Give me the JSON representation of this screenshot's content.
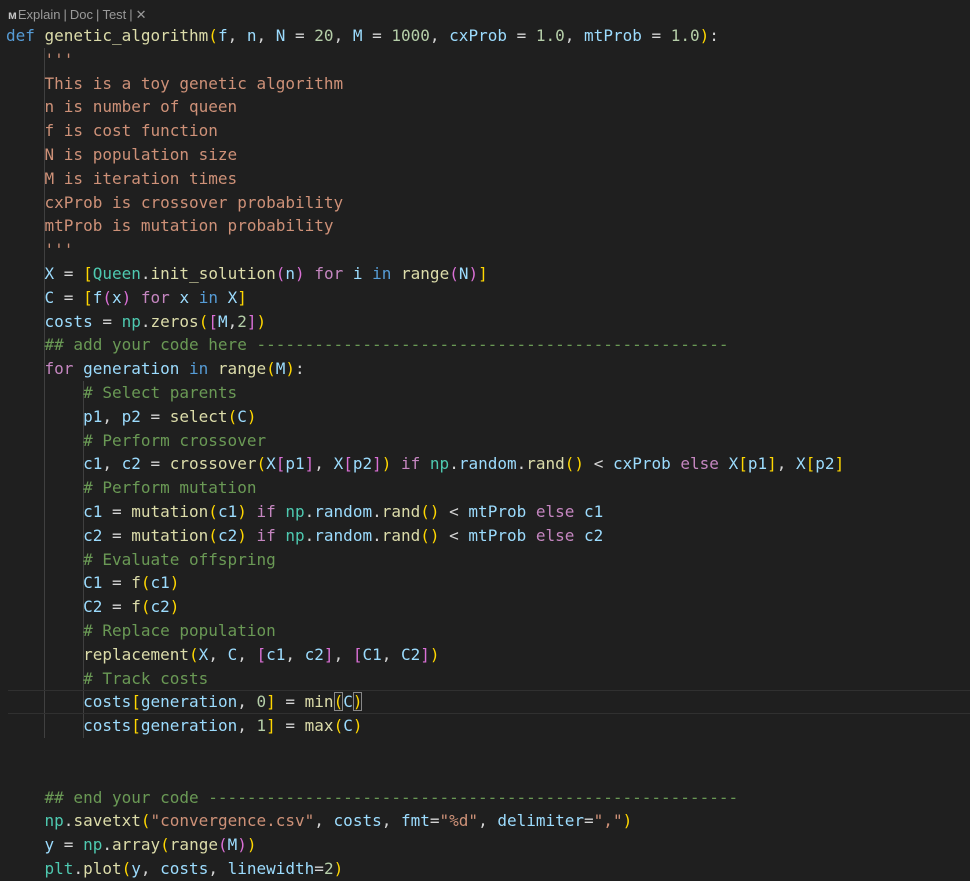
{
  "codelens": {
    "explain": "Explain",
    "doc": "Doc",
    "test": "Test",
    "separator": "|"
  },
  "colors": {
    "background": "#1f1f1f",
    "keyword": "#569cd6",
    "function": "#dcdcaa",
    "variable": "#9cdcfe",
    "class": "#4ec9b0",
    "number": "#b5cea8",
    "string": "#ce9178",
    "comment": "#6a9955",
    "control": "#c586c0"
  },
  "lines": [
    [
      [
        "kw",
        "def "
      ],
      [
        "fn",
        "genetic_algorithm"
      ],
      [
        "b1",
        "("
      ],
      [
        "id",
        "f"
      ],
      [
        "p",
        ", "
      ],
      [
        "id",
        "n"
      ],
      [
        "p",
        ", "
      ],
      [
        "id",
        "N"
      ],
      [
        "p",
        " = "
      ],
      [
        "num",
        "20"
      ],
      [
        "p",
        ", "
      ],
      [
        "id",
        "M"
      ],
      [
        "p",
        " = "
      ],
      [
        "num",
        "1000"
      ],
      [
        "p",
        ", "
      ],
      [
        "id",
        "cxProb"
      ],
      [
        "p",
        " = "
      ],
      [
        "num",
        "1.0"
      ],
      [
        "p",
        ", "
      ],
      [
        "id",
        "mtProb"
      ],
      [
        "p",
        " = "
      ],
      [
        "num",
        "1.0"
      ],
      [
        "b1",
        ")"
      ],
      [
        "p",
        ":"
      ]
    ],
    [
      [
        "p",
        "    "
      ],
      [
        "str",
        "'''"
      ]
    ],
    [
      [
        "p",
        "    "
      ],
      [
        "str",
        "This is a toy genetic algorithm"
      ]
    ],
    [
      [
        "p",
        "    "
      ],
      [
        "str",
        "n is number of queen"
      ]
    ],
    [
      [
        "p",
        "    "
      ],
      [
        "str",
        "f is cost function"
      ]
    ],
    [
      [
        "p",
        "    "
      ],
      [
        "str",
        "N is population size"
      ]
    ],
    [
      [
        "p",
        "    "
      ],
      [
        "str",
        "M is iteration times"
      ]
    ],
    [
      [
        "p",
        "    "
      ],
      [
        "str",
        "cxProb is crossover probability"
      ]
    ],
    [
      [
        "p",
        "    "
      ],
      [
        "str",
        "mtProb is mutation probability"
      ]
    ],
    [
      [
        "p",
        "    "
      ],
      [
        "str",
        "'''"
      ]
    ],
    [
      [
        "p",
        "    "
      ],
      [
        "id",
        "X"
      ],
      [
        "p",
        " = "
      ],
      [
        "b1",
        "["
      ],
      [
        "cl",
        "Queen"
      ],
      [
        "p",
        "."
      ],
      [
        "fn",
        "init_solution"
      ],
      [
        "b2",
        "("
      ],
      [
        "id",
        "n"
      ],
      [
        "b2",
        ")"
      ],
      [
        "ctl",
        " for "
      ],
      [
        "id",
        "i"
      ],
      [
        "kw",
        " in "
      ],
      [
        "fn",
        "range"
      ],
      [
        "b2",
        "("
      ],
      [
        "id",
        "N"
      ],
      [
        "b2",
        ")"
      ],
      [
        "b1",
        "]"
      ]
    ],
    [
      [
        "p",
        "    "
      ],
      [
        "id",
        "C"
      ],
      [
        "p",
        " = "
      ],
      [
        "b1",
        "["
      ],
      [
        "id",
        "f"
      ],
      [
        "b2",
        "("
      ],
      [
        "id",
        "x"
      ],
      [
        "b2",
        ")"
      ],
      [
        "ctl",
        " for "
      ],
      [
        "id",
        "x"
      ],
      [
        "kw",
        " in "
      ],
      [
        "id",
        "X"
      ],
      [
        "b1",
        "]"
      ]
    ],
    [
      [
        "p",
        "    "
      ],
      [
        "id",
        "costs"
      ],
      [
        "p",
        " = "
      ],
      [
        "cl",
        "np"
      ],
      [
        "p",
        "."
      ],
      [
        "fn",
        "zeros"
      ],
      [
        "b1",
        "("
      ],
      [
        "b2",
        "["
      ],
      [
        "id",
        "M"
      ],
      [
        "p",
        ","
      ],
      [
        "num",
        "2"
      ],
      [
        "b2",
        "]"
      ],
      [
        "b1",
        ")"
      ]
    ],
    [
      [
        "p",
        "    "
      ],
      [
        "cm",
        "## add your code here -------------------------------------------------"
      ]
    ],
    [
      [
        "p",
        "    "
      ],
      [
        "ctl",
        "for "
      ],
      [
        "id",
        "generation"
      ],
      [
        "kw",
        " in "
      ],
      [
        "fn",
        "range"
      ],
      [
        "b1",
        "("
      ],
      [
        "id",
        "M"
      ],
      [
        "b1",
        ")"
      ],
      [
        "p",
        ":"
      ]
    ],
    [
      [
        "p",
        "        "
      ],
      [
        "cm",
        "# Select parents"
      ]
    ],
    [
      [
        "p",
        "        "
      ],
      [
        "id",
        "p1"
      ],
      [
        "p",
        ", "
      ],
      [
        "id",
        "p2"
      ],
      [
        "p",
        " = "
      ],
      [
        "fn",
        "select"
      ],
      [
        "b1",
        "("
      ],
      [
        "id",
        "C"
      ],
      [
        "b1",
        ")"
      ]
    ],
    [
      [
        "p",
        "        "
      ],
      [
        "cm",
        "# Perform crossover"
      ]
    ],
    [
      [
        "p",
        "        "
      ],
      [
        "id",
        "c1"
      ],
      [
        "p",
        ", "
      ],
      [
        "id",
        "c2"
      ],
      [
        "p",
        " = "
      ],
      [
        "fn",
        "crossover"
      ],
      [
        "b1",
        "("
      ],
      [
        "id",
        "X"
      ],
      [
        "b2",
        "["
      ],
      [
        "id",
        "p1"
      ],
      [
        "b2",
        "]"
      ],
      [
        "p",
        ", "
      ],
      [
        "id",
        "X"
      ],
      [
        "b2",
        "["
      ],
      [
        "id",
        "p2"
      ],
      [
        "b2",
        "]"
      ],
      [
        "b1",
        ")"
      ],
      [
        "ctl",
        " if "
      ],
      [
        "cl",
        "np"
      ],
      [
        "p",
        "."
      ],
      [
        "id",
        "random"
      ],
      [
        "p",
        "."
      ],
      [
        "fn",
        "rand"
      ],
      [
        "b1",
        "()"
      ],
      [
        "p",
        " < "
      ],
      [
        "id",
        "cxProb"
      ],
      [
        "ctl",
        " else "
      ],
      [
        "id",
        "X"
      ],
      [
        "b1",
        "["
      ],
      [
        "id",
        "p1"
      ],
      [
        "b1",
        "]"
      ],
      [
        "p",
        ", "
      ],
      [
        "id",
        "X"
      ],
      [
        "b1",
        "["
      ],
      [
        "id",
        "p2"
      ],
      [
        "b1",
        "]"
      ]
    ],
    [
      [
        "p",
        "        "
      ],
      [
        "cm",
        "# Perform mutation"
      ]
    ],
    [
      [
        "p",
        "        "
      ],
      [
        "id",
        "c1"
      ],
      [
        "p",
        " = "
      ],
      [
        "fn",
        "mutation"
      ],
      [
        "b1",
        "("
      ],
      [
        "id",
        "c1"
      ],
      [
        "b1",
        ")"
      ],
      [
        "ctl",
        " if "
      ],
      [
        "cl",
        "np"
      ],
      [
        "p",
        "."
      ],
      [
        "id",
        "random"
      ],
      [
        "p",
        "."
      ],
      [
        "fn",
        "rand"
      ],
      [
        "b1",
        "()"
      ],
      [
        "p",
        " < "
      ],
      [
        "id",
        "mtProb"
      ],
      [
        "ctl",
        " else "
      ],
      [
        "id",
        "c1"
      ]
    ],
    [
      [
        "p",
        "        "
      ],
      [
        "id",
        "c2"
      ],
      [
        "p",
        " = "
      ],
      [
        "fn",
        "mutation"
      ],
      [
        "b1",
        "("
      ],
      [
        "id",
        "c2"
      ],
      [
        "b1",
        ")"
      ],
      [
        "ctl",
        " if "
      ],
      [
        "cl",
        "np"
      ],
      [
        "p",
        "."
      ],
      [
        "id",
        "random"
      ],
      [
        "p",
        "."
      ],
      [
        "fn",
        "rand"
      ],
      [
        "b1",
        "()"
      ],
      [
        "p",
        " < "
      ],
      [
        "id",
        "mtProb"
      ],
      [
        "ctl",
        " else "
      ],
      [
        "id",
        "c2"
      ]
    ],
    [
      [
        "p",
        "        "
      ],
      [
        "cm",
        "# Evaluate offspring"
      ]
    ],
    [
      [
        "p",
        "        "
      ],
      [
        "id",
        "C1"
      ],
      [
        "p",
        " = "
      ],
      [
        "fn",
        "f"
      ],
      [
        "b1",
        "("
      ],
      [
        "id",
        "c1"
      ],
      [
        "b1",
        ")"
      ]
    ],
    [
      [
        "p",
        "        "
      ],
      [
        "id",
        "C2"
      ],
      [
        "p",
        " = "
      ],
      [
        "fn",
        "f"
      ],
      [
        "b1",
        "("
      ],
      [
        "id",
        "c2"
      ],
      [
        "b1",
        ")"
      ]
    ],
    [
      [
        "p",
        "        "
      ],
      [
        "cm",
        "# Replace population"
      ]
    ],
    [
      [
        "p",
        "        "
      ],
      [
        "fn",
        "replacement"
      ],
      [
        "b1",
        "("
      ],
      [
        "id",
        "X"
      ],
      [
        "p",
        ", "
      ],
      [
        "id",
        "C"
      ],
      [
        "p",
        ", "
      ],
      [
        "b2",
        "["
      ],
      [
        "id",
        "c1"
      ],
      [
        "p",
        ", "
      ],
      [
        "id",
        "c2"
      ],
      [
        "b2",
        "]"
      ],
      [
        "p",
        ", "
      ],
      [
        "b2",
        "["
      ],
      [
        "id",
        "C1"
      ],
      [
        "p",
        ", "
      ],
      [
        "id",
        "C2"
      ],
      [
        "b2",
        "]"
      ],
      [
        "b1",
        ")"
      ]
    ],
    [
      [
        "p",
        "        "
      ],
      [
        "cm",
        "# Track costs"
      ]
    ],
    [
      [
        "p",
        "        "
      ],
      [
        "id",
        "costs"
      ],
      [
        "b1",
        "["
      ],
      [
        "id",
        "generation"
      ],
      [
        "p",
        ", "
      ],
      [
        "num",
        "0"
      ],
      [
        "b1",
        "]"
      ],
      [
        "p",
        " = "
      ],
      [
        "fn",
        "min"
      ],
      [
        "b1 br",
        "("
      ],
      [
        "id",
        "C"
      ],
      [
        "b1 br",
        ")"
      ]
    ],
    [
      [
        "p",
        "        "
      ],
      [
        "id",
        "costs"
      ],
      [
        "b1",
        "["
      ],
      [
        "id",
        "generation"
      ],
      [
        "p",
        ", "
      ],
      [
        "num",
        "1"
      ],
      [
        "b1",
        "]"
      ],
      [
        "p",
        " = "
      ],
      [
        "fn",
        "max"
      ],
      [
        "b1",
        "("
      ],
      [
        "id",
        "C"
      ],
      [
        "b1",
        ")"
      ]
    ],
    [],
    [],
    [
      [
        "p",
        "    "
      ],
      [
        "cm",
        "## end your code -------------------------------------------------------"
      ]
    ],
    [
      [
        "p",
        "    "
      ],
      [
        "cl",
        "np"
      ],
      [
        "p",
        "."
      ],
      [
        "fn",
        "savetxt"
      ],
      [
        "b1",
        "("
      ],
      [
        "str",
        "\"convergence.csv\""
      ],
      [
        "p",
        ", "
      ],
      [
        "id",
        "costs"
      ],
      [
        "p",
        ", "
      ],
      [
        "id",
        "fmt"
      ],
      [
        "p",
        "="
      ],
      [
        "str",
        "\"%d\""
      ],
      [
        "p",
        ", "
      ],
      [
        "id",
        "delimiter"
      ],
      [
        "p",
        "="
      ],
      [
        "str",
        "\",\""
      ],
      [
        "b1",
        ")"
      ]
    ],
    [
      [
        "p",
        "    "
      ],
      [
        "id",
        "y"
      ],
      [
        "p",
        " = "
      ],
      [
        "cl",
        "np"
      ],
      [
        "p",
        "."
      ],
      [
        "fn",
        "array"
      ],
      [
        "b1",
        "("
      ],
      [
        "fn",
        "range"
      ],
      [
        "b2",
        "("
      ],
      [
        "id",
        "M"
      ],
      [
        "b2",
        ")"
      ],
      [
        "b1",
        ")"
      ]
    ],
    [
      [
        "p",
        "    "
      ],
      [
        "cl",
        "plt"
      ],
      [
        "p",
        "."
      ],
      [
        "fn",
        "plot"
      ],
      [
        "b1",
        "("
      ],
      [
        "id",
        "y"
      ],
      [
        "p",
        ", "
      ],
      [
        "id",
        "costs"
      ],
      [
        "p",
        ", "
      ],
      [
        "id",
        "linewidth"
      ],
      [
        "p",
        "="
      ],
      [
        "num",
        "2"
      ],
      [
        "b1",
        ")"
      ]
    ]
  ]
}
